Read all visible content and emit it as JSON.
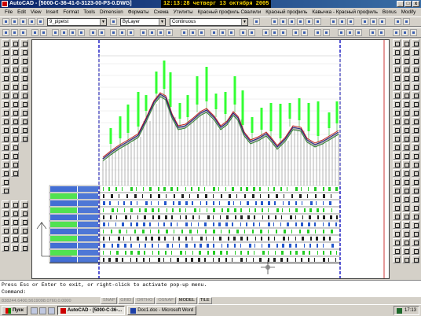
{
  "window": {
    "title": "AutoCAD - [5000-С-36-41-0-3123-00-Р3-0.DWG]",
    "clock": "12:13:28 четверг 13 октября 2005"
  },
  "menu": [
    "File",
    "Edit",
    "View",
    "Insert",
    "Format",
    "Tools",
    "Dimension",
    "Форматы",
    "Схема",
    "Утилиты",
    "Красный профиль Свалили",
    "Красный профиль",
    "Кавычка - Красный профиль",
    "Bonus",
    "Modify"
  ],
  "toolbar": {
    "layer": "9_pipetst",
    "color": "ByLayer",
    "linetype": "Continuous"
  },
  "command": {
    "line1": "Press Esc or Enter to exit, or right-click to activate pop-up menu.",
    "line2": "Command:"
  },
  "status": {
    "coords": "838244.6400,5619098.0760,0.0000",
    "toggles": [
      "SNAP",
      "GRID",
      "ORTHO",
      "OSNAP",
      "MODEL",
      "TILE"
    ]
  },
  "taskbar": {
    "start": "Пуск",
    "tasks": [
      "AutoCAD - [5000-С-36-...",
      "Doc1.doc - Microsoft Word"
    ],
    "time": "17:13"
  },
  "icons": {
    "app": "autocad-icon",
    "start": "windows-logo-icon",
    "word": "word-icon"
  }
}
